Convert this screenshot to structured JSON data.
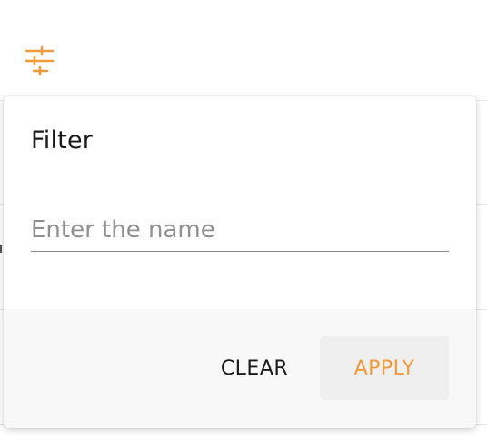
{
  "toolbar": {
    "filter_icon": "sliders-icon",
    "filter_icon_color": "#f29a3a"
  },
  "filter_popover": {
    "title": "Filter",
    "name_input": {
      "value": "",
      "placeholder": "Enter the name"
    },
    "clear_label": "CLEAR",
    "apply_label": "APPLY"
  },
  "colors": {
    "accent": "#f29a3a",
    "text": "#1a1a1a",
    "placeholder": "#8f8f8f",
    "footer_bg": "#f8f8f8",
    "apply_bg": "#efefef"
  }
}
